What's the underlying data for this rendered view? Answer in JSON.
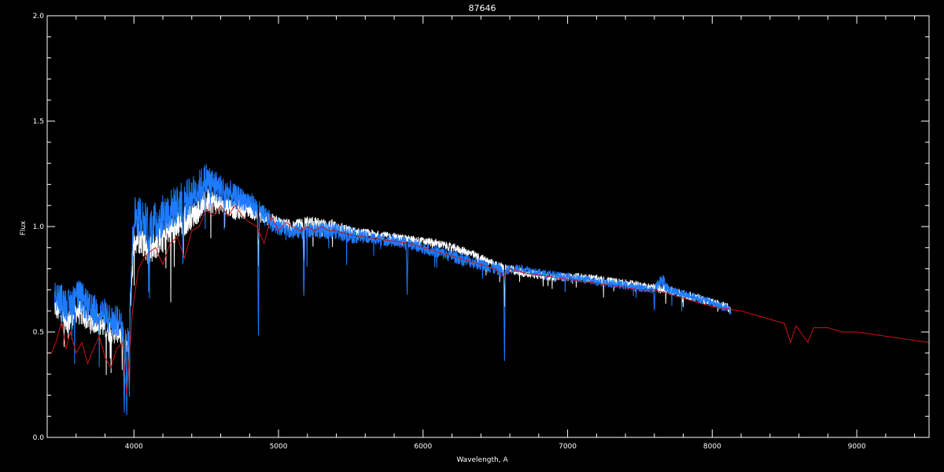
{
  "chart_data": {
    "type": "line",
    "title": "87646",
    "xlabel": "Wavelength, A",
    "ylabel": "Flux",
    "xlim": [
      3400,
      9500
    ],
    "ylim": [
      0.0,
      2.0
    ],
    "x_ticks": [
      4000,
      5000,
      6000,
      7000,
      8000,
      9000
    ],
    "x_tick_labels": [
      "4000",
      "5000",
      "6000",
      "7000",
      "8000",
      "9000"
    ],
    "y_ticks": [
      0.0,
      0.5,
      1.0,
      1.5,
      2.0
    ],
    "y_tick_labels": [
      "0.0",
      "0.5",
      "1.0",
      "1.5",
      "2.0"
    ],
    "grid": false,
    "background": "#000000",
    "series": [
      {
        "color": "#ffffff",
        "style": "noisy-spectrum",
        "x": [
          3450,
          3500,
          3550,
          3600,
          3650,
          3700,
          3750,
          3800,
          3850,
          3900,
          3930,
          3960,
          4000,
          4050,
          4100,
          4150,
          4200,
          4250,
          4300,
          4350,
          4400,
          4450,
          4500,
          4550,
          4600,
          4650,
          4700,
          4800,
          4900,
          5000,
          5100,
          5200,
          5300,
          5400,
          5500,
          5600,
          5700,
          5800,
          5900,
          6000,
          6100,
          6200,
          6300,
          6400,
          6500,
          6560,
          6600,
          6700,
          6800,
          6900,
          7000,
          7100,
          7200,
          7300,
          7400,
          7500,
          7600,
          7700,
          7800,
          7900,
          8000,
          8100,
          8130
        ],
        "y": [
          0.62,
          0.58,
          0.55,
          0.6,
          0.58,
          0.55,
          0.55,
          0.52,
          0.5,
          0.5,
          0.45,
          0.45,
          0.95,
          0.95,
          0.9,
          0.92,
          0.95,
          0.98,
          1.0,
          1.03,
          1.05,
          1.08,
          1.12,
          1.12,
          1.1,
          1.1,
          1.08,
          1.08,
          1.04,
          1.02,
          1.0,
          1.02,
          1.01,
          1.0,
          0.98,
          0.97,
          0.96,
          0.95,
          0.94,
          0.93,
          0.92,
          0.9,
          0.88,
          0.85,
          0.82,
          0.8,
          0.8,
          0.78,
          0.77,
          0.76,
          0.76,
          0.76,
          0.75,
          0.74,
          0.73,
          0.72,
          0.71,
          0.7,
          0.68,
          0.66,
          0.64,
          0.62,
          0.6
        ],
        "noise": [
          0.05,
          0.06,
          0.06,
          0.06,
          0.06,
          0.06,
          0.06,
          0.06,
          0.06,
          0.05,
          0.05,
          0.05,
          0.08,
          0.08,
          0.08,
          0.08,
          0.08,
          0.08,
          0.08,
          0.08,
          0.06,
          0.06,
          0.06,
          0.06,
          0.05,
          0.05,
          0.05,
          0.04,
          0.03,
          0.03,
          0.03,
          0.03,
          0.03,
          0.03,
          0.02,
          0.02,
          0.02,
          0.02,
          0.02,
          0.02,
          0.02,
          0.02,
          0.02,
          0.02,
          0.02,
          0.02,
          0.02,
          0.02,
          0.02,
          0.02,
          0.02,
          0.02,
          0.02,
          0.02,
          0.02,
          0.02,
          0.02,
          0.02,
          0.02,
          0.02,
          0.02,
          0.02,
          0.02
        ],
        "dips": [
          [
            3933,
            0.28
          ],
          [
            3968,
            0.3
          ],
          [
            4102,
            0.12
          ],
          [
            4340,
            0.2
          ],
          [
            4861,
            0.25
          ],
          [
            5175,
            0.18
          ],
          [
            6563,
            0.18
          ]
        ]
      },
      {
        "color": "#1e7cff",
        "style": "noisy-spectrum",
        "x": [
          3450,
          3500,
          3550,
          3600,
          3650,
          3700,
          3750,
          3800,
          3850,
          3900,
          3930,
          3960,
          4000,
          4050,
          4100,
          4150,
          4200,
          4250,
          4300,
          4350,
          4400,
          4450,
          4500,
          4550,
          4600,
          4650,
          4700,
          4800,
          4900,
          5000,
          5100,
          5200,
          5300,
          5400,
          5500,
          5600,
          5700,
          5800,
          5900,
          6000,
          6100,
          6200,
          6300,
          6400,
          6500,
          6560,
          6600,
          6700,
          6800,
          6900,
          7000,
          7100,
          7200,
          7300,
          7400,
          7500,
          7600,
          7650,
          7700,
          7800,
          7900,
          8000,
          8100,
          8130
        ],
        "y": [
          0.68,
          0.65,
          0.62,
          0.68,
          0.65,
          0.6,
          0.6,
          0.58,
          0.55,
          0.55,
          0.48,
          0.5,
          1.05,
          1.05,
          1.0,
          1.02,
          1.05,
          1.08,
          1.1,
          1.12,
          1.15,
          1.18,
          1.22,
          1.2,
          1.18,
          1.16,
          1.14,
          1.12,
          1.05,
          1.0,
          0.98,
          0.98,
          0.98,
          0.98,
          0.96,
          0.95,
          0.94,
          0.93,
          0.92,
          0.9,
          0.88,
          0.86,
          0.84,
          0.82,
          0.8,
          0.78,
          0.8,
          0.8,
          0.78,
          0.77,
          0.76,
          0.75,
          0.74,
          0.73,
          0.72,
          0.71,
          0.7,
          0.75,
          0.7,
          0.68,
          0.66,
          0.64,
          0.61,
          0.6
        ],
        "noise": [
          0.07,
          0.08,
          0.08,
          0.08,
          0.08,
          0.08,
          0.08,
          0.08,
          0.08,
          0.07,
          0.07,
          0.07,
          0.1,
          0.1,
          0.1,
          0.1,
          0.1,
          0.1,
          0.1,
          0.1,
          0.09,
          0.09,
          0.09,
          0.08,
          0.07,
          0.07,
          0.06,
          0.05,
          0.05,
          0.04,
          0.04,
          0.04,
          0.04,
          0.04,
          0.04,
          0.03,
          0.03,
          0.03,
          0.03,
          0.03,
          0.03,
          0.03,
          0.03,
          0.03,
          0.03,
          0.03,
          0.02,
          0.02,
          0.02,
          0.02,
          0.02,
          0.02,
          0.02,
          0.02,
          0.02,
          0.02,
          0.02,
          0.04,
          0.02,
          0.02,
          0.02,
          0.02,
          0.02,
          0.02
        ],
        "dips": [
          [
            3933,
            0.35
          ],
          [
            3968,
            0.38
          ],
          [
            3950,
            0.4
          ],
          [
            4102,
            0.25
          ],
          [
            4340,
            0.3
          ],
          [
            4861,
            0.6
          ],
          [
            5175,
            0.35
          ],
          [
            5890,
            0.25
          ],
          [
            6563,
            0.45
          ],
          [
            7600,
            0.1
          ]
        ]
      },
      {
        "color": "#cc1414",
        "style": "model-spectrum",
        "x": [
          3400,
          3430,
          3460,
          3500,
          3530,
          3560,
          3600,
          3640,
          3680,
          3720,
          3760,
          3800,
          3840,
          3880,
          3920,
          3950,
          3990,
          4030,
          4070,
          4110,
          4150,
          4200,
          4250,
          4300,
          4350,
          4400,
          4450,
          4500,
          4550,
          4600,
          4650,
          4700,
          4750,
          4800,
          4850,
          4900,
          4950,
          5000,
          5050,
          5100,
          5150,
          5200,
          5250,
          5300,
          5350,
          5400,
          5500,
          5600,
          5700,
          5800,
          5900,
          6000,
          6100,
          6200,
          6300,
          6400,
          6500,
          6560,
          6600,
          6700,
          6800,
          6900,
          7000,
          7100,
          7200,
          7300,
          7400,
          7500,
          7600,
          7700,
          7800,
          7900,
          8000,
          8100,
          8200,
          8300,
          8400,
          8450,
          8500,
          8542,
          8580,
          8662,
          8700,
          8800,
          8900,
          9000,
          9100,
          9200,
          9300,
          9400,
          9500
        ],
        "y": [
          0.4,
          0.4,
          0.45,
          0.55,
          0.42,
          0.5,
          0.4,
          0.45,
          0.35,
          0.42,
          0.48,
          0.38,
          0.33,
          0.42,
          0.45,
          0.2,
          0.6,
          0.8,
          0.85,
          0.88,
          0.9,
          0.82,
          0.92,
          0.95,
          0.85,
          0.98,
          1.0,
          1.08,
          1.05,
          1.1,
          1.05,
          1.1,
          1.05,
          1.02,
          1.0,
          0.92,
          1.05,
          0.98,
          1.02,
          1.0,
          0.98,
          1.0,
          0.98,
          1.0,
          0.98,
          0.98,
          0.96,
          0.95,
          0.94,
          0.93,
          0.92,
          0.9,
          0.88,
          0.86,
          0.84,
          0.82,
          0.8,
          0.76,
          0.8,
          0.78,
          0.77,
          0.76,
          0.75,
          0.74,
          0.73,
          0.72,
          0.71,
          0.7,
          0.7,
          0.68,
          0.66,
          0.64,
          0.62,
          0.61,
          0.6,
          0.58,
          0.56,
          0.55,
          0.54,
          0.45,
          0.53,
          0.45,
          0.52,
          0.52,
          0.5,
          0.5,
          0.49,
          0.48,
          0.47,
          0.46,
          0.45
        ]
      }
    ]
  }
}
